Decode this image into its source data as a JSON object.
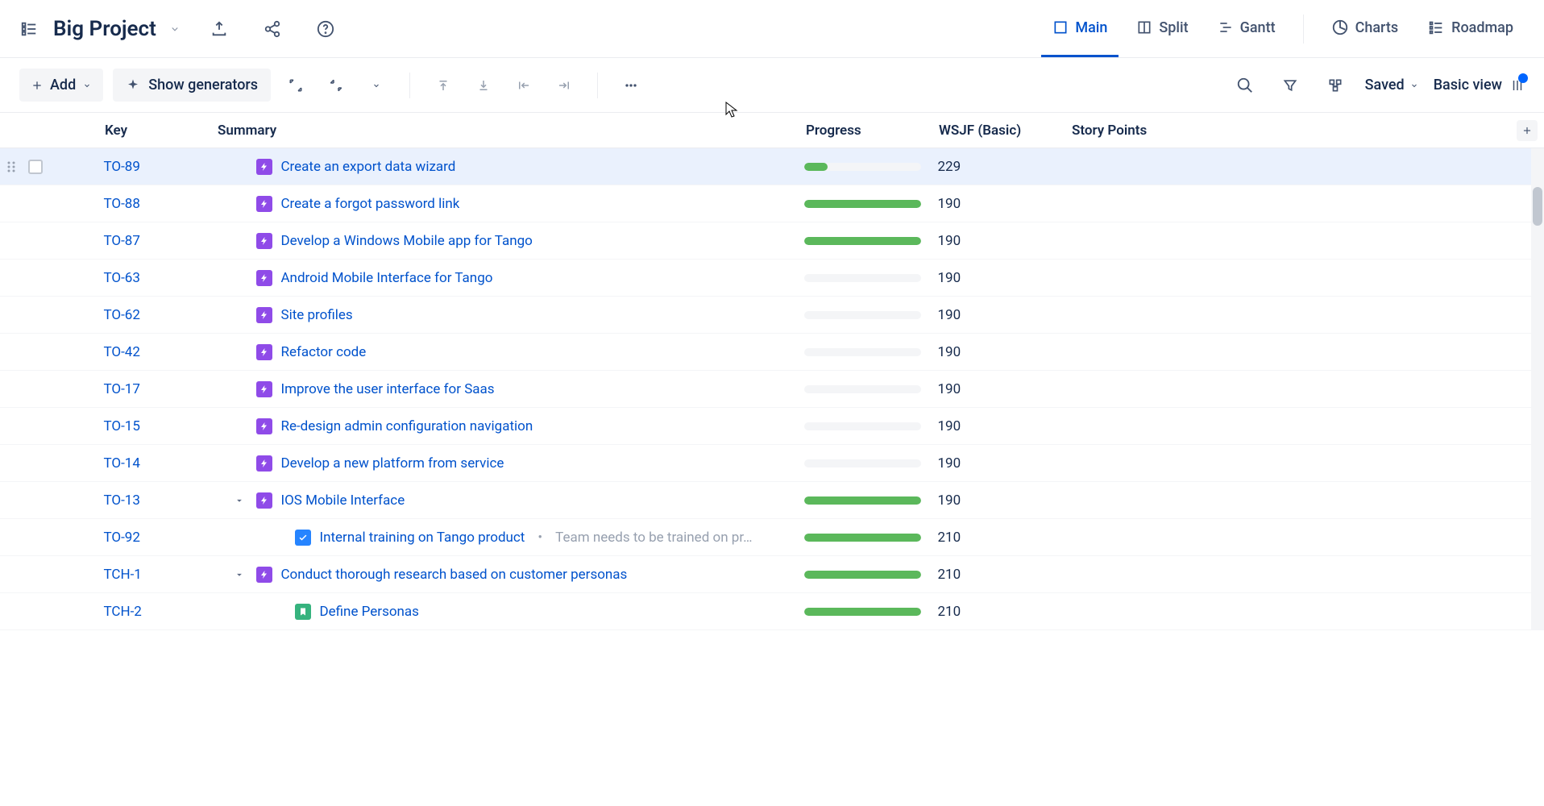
{
  "project": {
    "name": "Big Project"
  },
  "header_tabs": [
    {
      "id": "main",
      "label": "Main",
      "active": true
    },
    {
      "id": "split",
      "label": "Split",
      "active": false
    },
    {
      "id": "gantt",
      "label": "Gantt",
      "active": false
    },
    {
      "id": "charts",
      "label": "Charts",
      "active": false
    },
    {
      "id": "roadmap",
      "label": "Roadmap",
      "active": false
    }
  ],
  "toolbar": {
    "add_label": "Add",
    "generators_label": "Show generators",
    "saved_label": "Saved",
    "view_label": "Basic view"
  },
  "columns": {
    "key": "Key",
    "summary": "Summary",
    "progress": "Progress",
    "wsjf": "WSJF (Basic)",
    "story_points": "Story Points"
  },
  "rows": [
    {
      "key": "TO-89",
      "summary": "Create an export data wizard",
      "progress": 20,
      "wsjf": "229",
      "icon": "epic",
      "indent": 0,
      "expandable": false,
      "hovered": true
    },
    {
      "key": "TO-88",
      "summary": "Create a forgot password link",
      "progress": 100,
      "wsjf": "190",
      "icon": "epic",
      "indent": 0,
      "expandable": false
    },
    {
      "key": "TO-87",
      "summary": "Develop a Windows Mobile app for Tango",
      "progress": 100,
      "wsjf": "190",
      "icon": "epic",
      "indent": 0,
      "expandable": false
    },
    {
      "key": "TO-63",
      "summary": "Android Mobile Interface for Tango",
      "progress": 0,
      "wsjf": "190",
      "icon": "epic",
      "indent": 0,
      "expandable": false
    },
    {
      "key": "TO-62",
      "summary": "Site profiles",
      "progress": 0,
      "wsjf": "190",
      "icon": "epic",
      "indent": 0,
      "expandable": false
    },
    {
      "key": "TO-42",
      "summary": "Refactor code",
      "progress": 0,
      "wsjf": "190",
      "icon": "epic",
      "indent": 0,
      "expandable": false
    },
    {
      "key": "TO-17",
      "summary": "Improve the user interface for Saas",
      "progress": 0,
      "wsjf": "190",
      "icon": "epic",
      "indent": 0,
      "expandable": false
    },
    {
      "key": "TO-15",
      "summary": "Re-design admin configuration navigation",
      "progress": 0,
      "wsjf": "190",
      "icon": "epic",
      "indent": 0,
      "expandable": false
    },
    {
      "key": "TO-14",
      "summary": "Develop a new platform from service",
      "progress": 0,
      "wsjf": "190",
      "icon": "epic",
      "indent": 0,
      "expandable": false
    },
    {
      "key": "TO-13",
      "summary": "IOS Mobile Interface",
      "progress": 100,
      "wsjf": "190",
      "icon": "epic",
      "indent": 0,
      "expandable": true,
      "expanded": true
    },
    {
      "key": "TO-92",
      "summary": "Internal training on Tango product",
      "desc": "Team needs to be trained on pr…",
      "progress": 100,
      "wsjf": "210",
      "icon": "task",
      "indent": 1,
      "expandable": false
    },
    {
      "key": "TCH-1",
      "summary": "Conduct thorough research based on customer personas",
      "progress": 100,
      "wsjf": "210",
      "icon": "epic",
      "indent": 0,
      "expandable": true,
      "expanded": true
    },
    {
      "key": "TCH-2",
      "summary": "Define Personas",
      "progress": 100,
      "wsjf": "210",
      "icon": "story",
      "indent": 1,
      "expandable": false
    }
  ]
}
